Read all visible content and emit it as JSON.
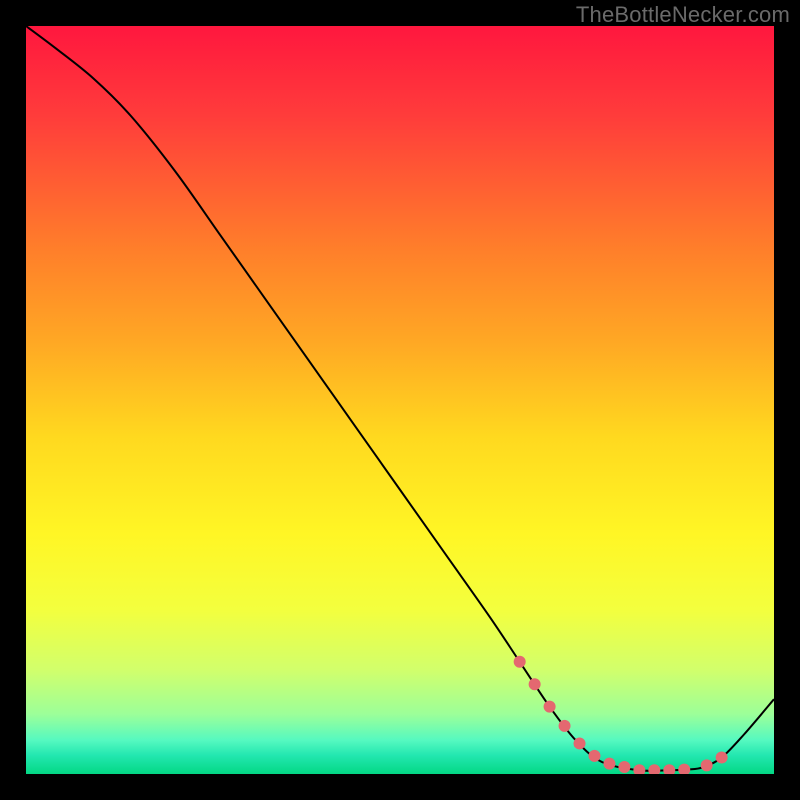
{
  "watermark": "TheBottleNecker.com",
  "colors": {
    "gradient_stops": [
      {
        "offset": 0.0,
        "color": "#ff173e"
      },
      {
        "offset": 0.12,
        "color": "#ff3c3b"
      },
      {
        "offset": 0.3,
        "color": "#ff7f2a"
      },
      {
        "offset": 0.42,
        "color": "#ffa724"
      },
      {
        "offset": 0.55,
        "color": "#ffd91f"
      },
      {
        "offset": 0.68,
        "color": "#fff625"
      },
      {
        "offset": 0.78,
        "color": "#f3ff3e"
      },
      {
        "offset": 0.86,
        "color": "#d2ff6b"
      },
      {
        "offset": 0.92,
        "color": "#9cff99"
      },
      {
        "offset": 0.955,
        "color": "#55f9c0"
      },
      {
        "offset": 0.975,
        "color": "#23e7b0"
      },
      {
        "offset": 1.0,
        "color": "#03d884"
      }
    ],
    "curve": "#000000",
    "marker": "#e46870",
    "frame": "#000000"
  },
  "chart_data": {
    "type": "line",
    "title": "",
    "xlabel": "",
    "ylabel": "",
    "xlim": [
      0,
      100
    ],
    "ylim": [
      0,
      100
    ],
    "grid": false,
    "legend": false,
    "series": [
      {
        "name": "bottleneck-curve",
        "x": [
          0,
          4,
          9,
          14,
          20,
          26,
          32,
          38,
          44,
          50,
          56,
          62,
          66,
          70,
          73.5,
          77,
          82,
          86,
          88.5,
          90.5,
          93,
          96,
          100
        ],
        "y": [
          100,
          97,
          93,
          88,
          80.5,
          72,
          63.5,
          55,
          46.5,
          38,
          29.5,
          21,
          15,
          9,
          4.5,
          1.6,
          0.5,
          0.5,
          0.6,
          0.9,
          2.2,
          5.3,
          10
        ]
      }
    ],
    "markers": {
      "name": "highlight-band",
      "x": [
        66,
        68,
        70,
        72,
        74,
        76,
        78,
        80,
        82,
        84,
        86,
        88,
        91,
        93
      ],
      "y_on_curve": true
    }
  }
}
